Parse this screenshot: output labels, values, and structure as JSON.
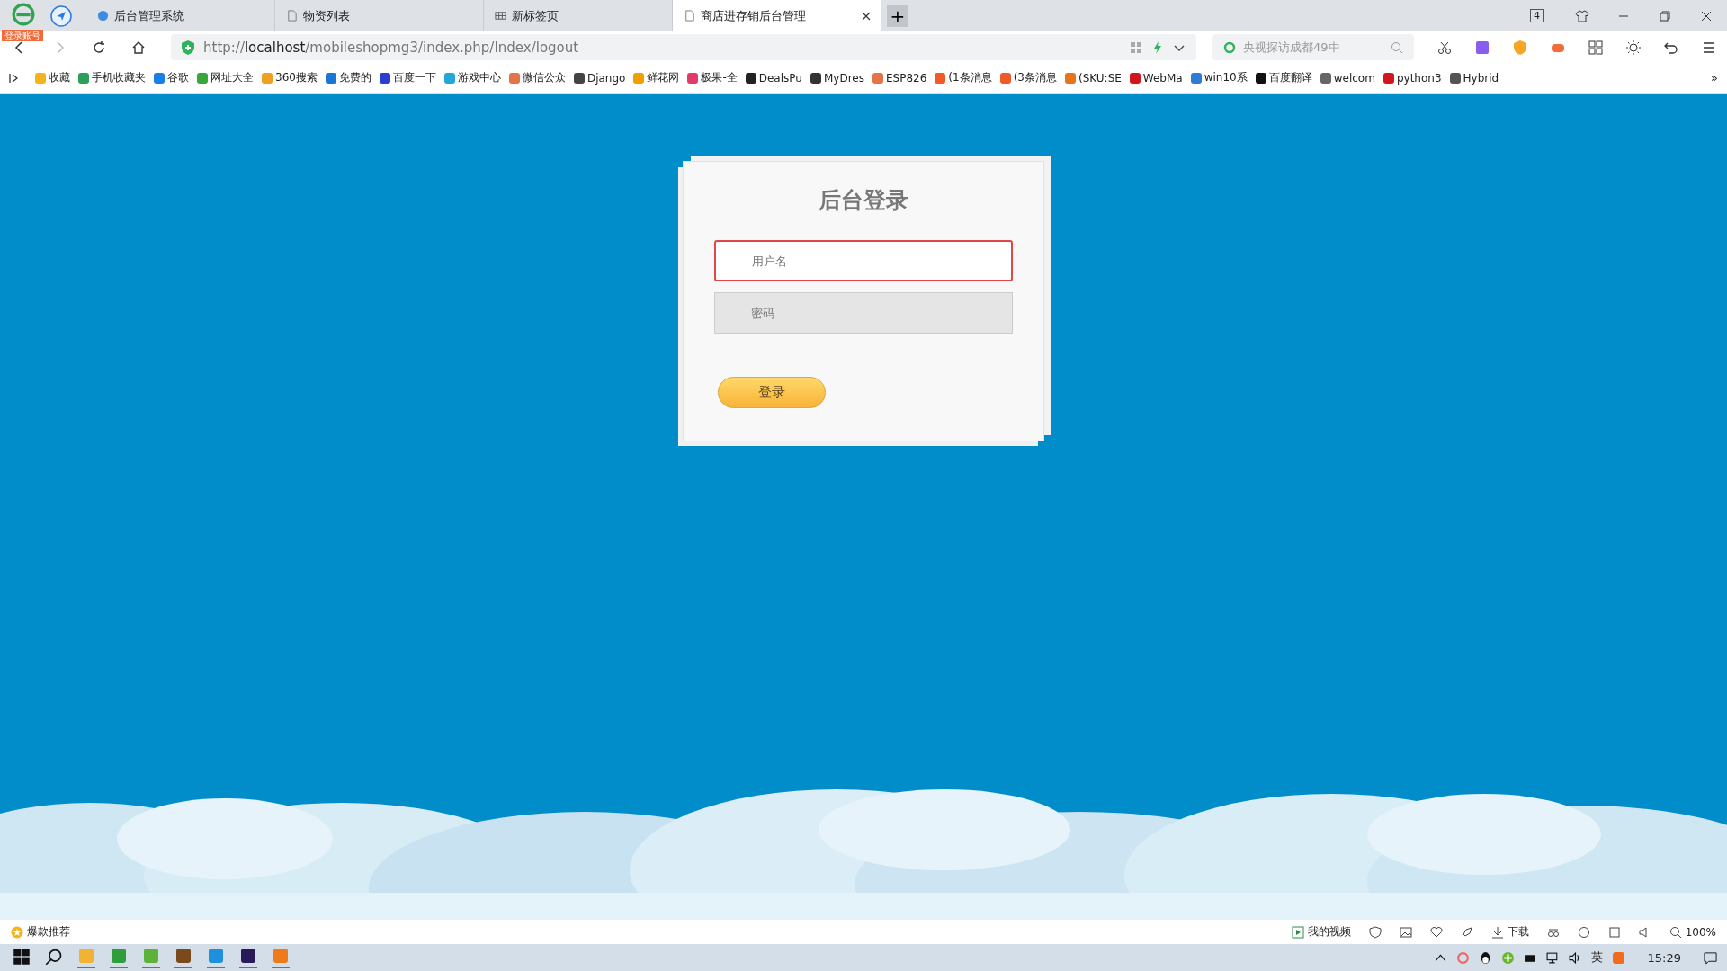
{
  "browser": {
    "account_badge": "登录账号",
    "tabs": [
      {
        "title": "后台管理系统",
        "selected": false,
        "kind": "site"
      },
      {
        "title": "物资列表",
        "selected": false,
        "kind": "page"
      },
      {
        "title": "新标签页",
        "selected": false,
        "kind": "grid"
      },
      {
        "title": "商店进存销后台管理",
        "selected": true,
        "kind": "page"
      }
    ],
    "new_tab": "+",
    "window_count": "4",
    "address": {
      "scheme": "http://",
      "host": "localhost",
      "path": "/mobileshopmg3/index.php/Index/logout"
    },
    "search": {
      "placeholder": "央视探访成都49中"
    },
    "bookmarks": [
      {
        "label": "收藏",
        "color": "#f5b21b"
      },
      {
        "label": "手机收藏夹",
        "color": "#2aa05a"
      },
      {
        "label": "谷歌",
        "color": "#1a7ee6"
      },
      {
        "label": "网址大全",
        "color": "#3aa53a"
      },
      {
        "label": "360搜索",
        "color": "#f0a020"
      },
      {
        "label": "免费的",
        "color": "#1976d2"
      },
      {
        "label": "百度一下",
        "color": "#2a3fd0"
      },
      {
        "label": "游戏中心",
        "color": "#23a7d8"
      },
      {
        "label": "微信公众",
        "color": "#e5734a"
      },
      {
        "label": "Django",
        "color": "#444444"
      },
      {
        "label": "鲜花网",
        "color": "#f2a000"
      },
      {
        "label": "极果-全",
        "color": "#e23b6a"
      },
      {
        "label": "DealsPu",
        "color": "#222222"
      },
      {
        "label": "MyDres",
        "color": "#333333"
      },
      {
        "label": "ESP826",
        "color": "#e5734a"
      },
      {
        "label": "(1条消息",
        "color": "#f05a28"
      },
      {
        "label": "(3条消息",
        "color": "#f05a28"
      },
      {
        "label": "(SKU:SE",
        "color": "#e8731a"
      },
      {
        "label": "WebMa",
        "color": "#d2161e"
      },
      {
        "label": "win10系",
        "color": "#2d7bd2"
      },
      {
        "label": "百度翻译",
        "color": "#111111"
      },
      {
        "label": "welcom",
        "color": "#666666"
      },
      {
        "label": "python3",
        "color": "#d2161e"
      },
      {
        "label": "Hybrid",
        "color": "#555555"
      }
    ],
    "more_bookmarks": "»"
  },
  "login": {
    "title": "后台登录",
    "fields": [
      {
        "placeholder": "用户名",
        "focused": true
      },
      {
        "placeholder": "密码",
        "focused": false
      }
    ],
    "button": "登录"
  },
  "status_bar": {
    "left": "爆款推荐",
    "video": "我的视频",
    "download": "下载",
    "zoom": "100%"
  },
  "taskbar": {
    "ime": "英",
    "clock": "15:29"
  }
}
